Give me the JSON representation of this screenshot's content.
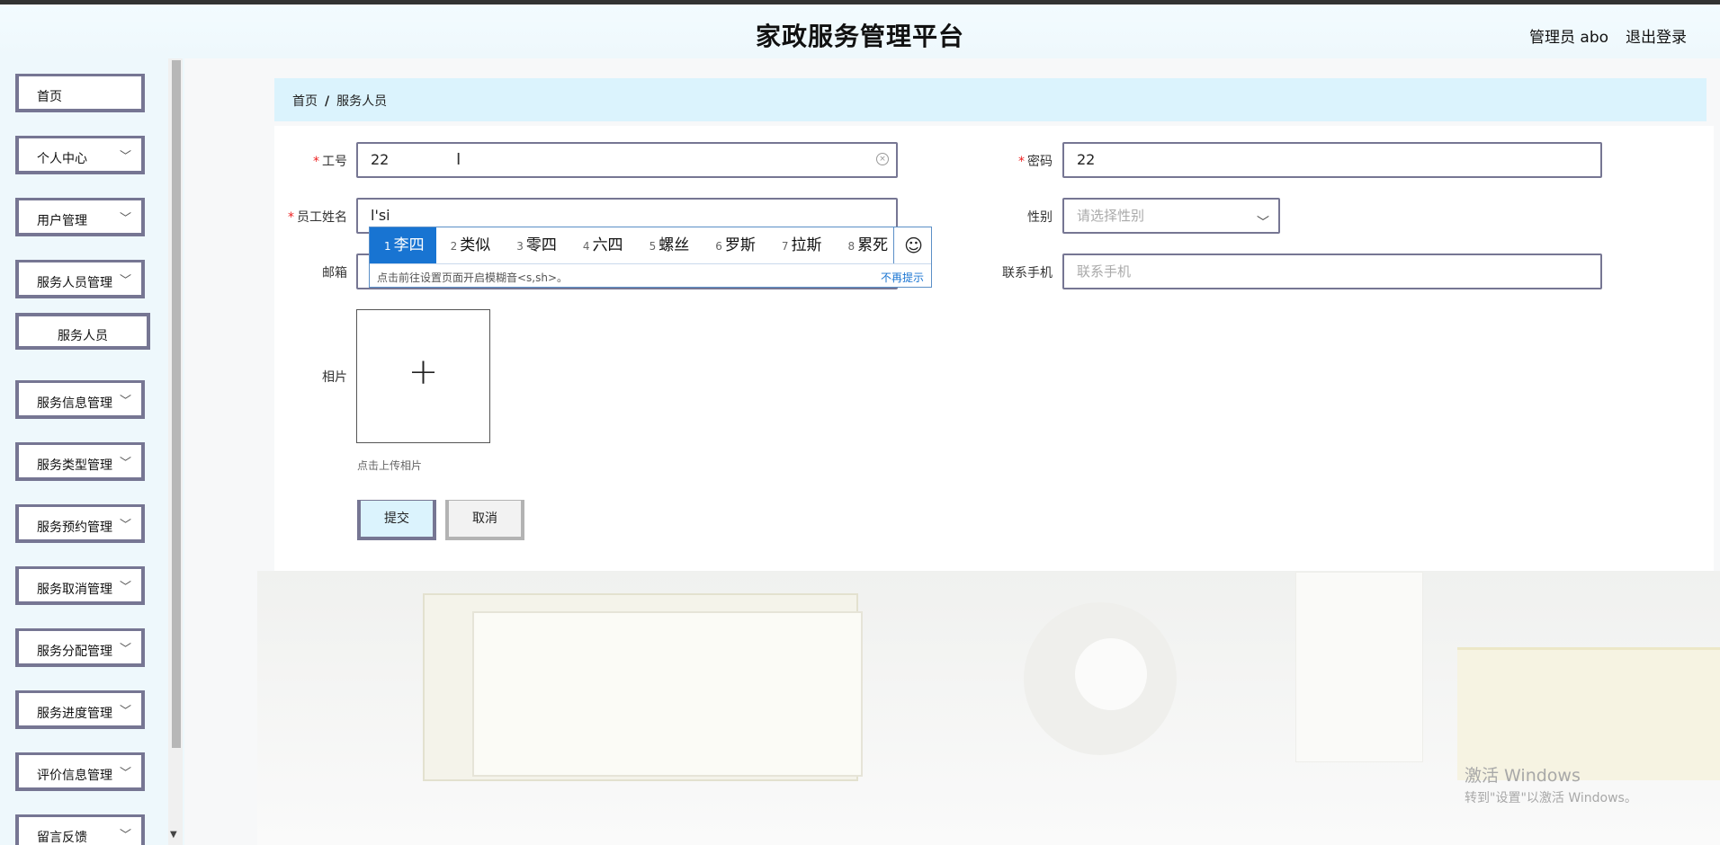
{
  "header": {
    "title": "家政服务管理平台",
    "admin_label": "管理员 abo",
    "logout_label": "退出登录"
  },
  "sidebar": {
    "items": [
      {
        "label": "首页",
        "has_chevron": false
      },
      {
        "label": "个人中心",
        "has_chevron": true
      },
      {
        "label": "用户管理",
        "has_chevron": true
      },
      {
        "label": "服务人员管理",
        "has_chevron": true
      },
      {
        "label": "服务信息管理",
        "has_chevron": true
      },
      {
        "label": "服务类型管理",
        "has_chevron": true
      },
      {
        "label": "服务预约管理",
        "has_chevron": true
      },
      {
        "label": "服务取消管理",
        "has_chevron": true
      },
      {
        "label": "服务分配管理",
        "has_chevron": true
      },
      {
        "label": "服务进度管理",
        "has_chevron": true
      },
      {
        "label": "评价信息管理",
        "has_chevron": true
      },
      {
        "label": "留言反馈",
        "has_chevron": true
      }
    ],
    "sub_item": {
      "label": "服务人员"
    }
  },
  "breadcrumb": {
    "home": "首页",
    "separator": "/",
    "current": "服务人员"
  },
  "form": {
    "employee_id": {
      "label": "工号",
      "value": "22",
      "required": true
    },
    "password": {
      "label": "密码",
      "value": "22",
      "required": true
    },
    "employee_name": {
      "label": "员工姓名",
      "value": "l'si",
      "required": true
    },
    "gender": {
      "label": "性别",
      "placeholder": "请选择性别"
    },
    "email": {
      "label": "邮箱",
      "value": ""
    },
    "phone": {
      "label": "联系手机",
      "placeholder": "联系手机"
    },
    "photo": {
      "label": "相片",
      "tip": "点击上传相片"
    },
    "submit_label": "提交",
    "cancel_label": "取消"
  },
  "ime": {
    "candidates": [
      {
        "num": "1",
        "text": "李四"
      },
      {
        "num": "2",
        "text": "类似"
      },
      {
        "num": "3",
        "text": "零四"
      },
      {
        "num": "4",
        "text": "六四"
      },
      {
        "num": "5",
        "text": "螺丝"
      },
      {
        "num": "6",
        "text": "罗斯"
      },
      {
        "num": "7",
        "text": "拉斯"
      },
      {
        "num": "8",
        "text": "累死"
      }
    ],
    "emoji": "☺",
    "hint": "点击前往设置页面开启模糊音<s,sh>。",
    "no_more": "不再提示"
  },
  "watermark": {
    "line1": "激活 Windows",
    "line2": "转到\"设置\"以激活 Windows。"
  }
}
